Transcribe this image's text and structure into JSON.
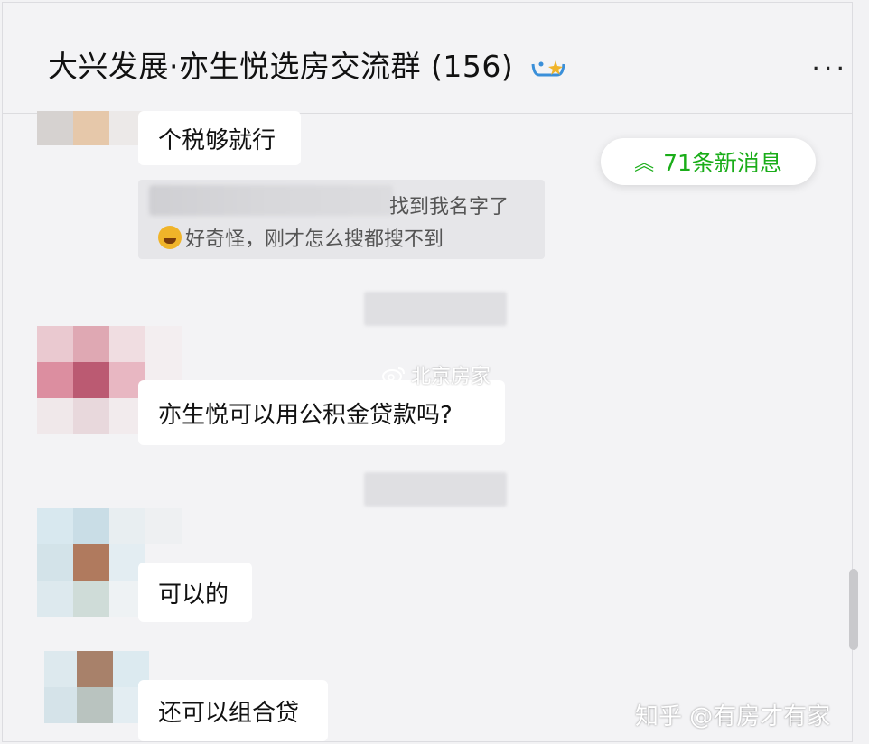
{
  "header": {
    "title": "大兴发展·亦生悦选房交流群",
    "member_count": "(156)",
    "more_icon": "more-dots-icon"
  },
  "new_messages_button": {
    "label": "71条新消息",
    "icon": "double-chevron-up-icon"
  },
  "messages": [
    {
      "text": "个税够就行"
    },
    {
      "quote_line1": "找到我名字了",
      "quote_line2": "好奇怪，刚才怎么搜都搜不到"
    },
    {
      "text": "亦生悦可以用公积金贷款吗?"
    },
    {
      "text": "可以的"
    },
    {
      "text": "还可以组合贷"
    }
  ],
  "watermarks": {
    "weibo": "北京房家",
    "zhihu": "知乎 @有房才有家"
  },
  "colors": {
    "accent_green": "#1aad19",
    "background": "#f3f3f5",
    "bubble": "#ffffff"
  }
}
